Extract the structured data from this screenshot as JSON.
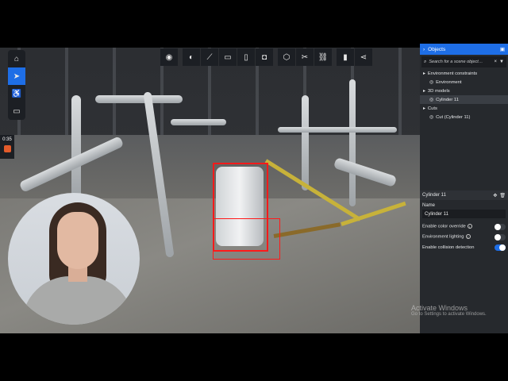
{
  "left_toolbar": {
    "items": [
      {
        "icon": "home-icon",
        "glyph": "⌂",
        "active": false
      },
      {
        "icon": "navigate-icon",
        "glyph": "➤",
        "active": true
      },
      {
        "icon": "walk-icon",
        "glyph": "♿",
        "active": false
      },
      {
        "icon": "vr-icon",
        "glyph": "▭",
        "active": false
      }
    ]
  },
  "recording": {
    "time": "0:35"
  },
  "top_toolbar": {
    "items": [
      {
        "icon": "eye-icon",
        "glyph": "◉"
      },
      {
        "icon": "contrast-icon",
        "glyph": "◐"
      },
      {
        "icon": "measure-icon",
        "glyph": "⟋"
      },
      {
        "icon": "comment-icon",
        "glyph": "▭"
      },
      {
        "icon": "document-icon",
        "glyph": "▯"
      },
      {
        "icon": "camera-icon",
        "glyph": "◘"
      },
      {
        "icon": "cube-icon",
        "glyph": "⬡"
      },
      {
        "icon": "scissors-icon",
        "glyph": "✂"
      },
      {
        "icon": "link-icon",
        "glyph": "⛓"
      },
      {
        "icon": "bookmark-icon",
        "glyph": "▮"
      },
      {
        "icon": "share-icon",
        "glyph": "⋖"
      }
    ]
  },
  "panel": {
    "title": "Objects",
    "search_placeholder": "Search for a scene object…",
    "tree": [
      {
        "label": "Environment constraints",
        "level": 0,
        "icon": "folder-icon"
      },
      {
        "label": "Environment",
        "level": 1,
        "icon": "object-icon"
      },
      {
        "label": "3D models",
        "level": 0,
        "icon": "folder-icon"
      },
      {
        "label": "Cylinder 11",
        "level": 1,
        "icon": "object-icon",
        "selected": true
      },
      {
        "label": "Cuts",
        "level": 0,
        "icon": "folder-icon"
      },
      {
        "label": "Cut (Cylinder 11)",
        "level": 1,
        "icon": "object-icon"
      }
    ],
    "properties": {
      "title": "Cylinder 11",
      "name_label": "Name",
      "name_value": "Cylinder 11",
      "toggles": [
        {
          "label": "Enable color override",
          "info": true,
          "on": false
        },
        {
          "label": "Environment lighting",
          "info": true,
          "on": false
        },
        {
          "label": "Enable collision detection",
          "info": false,
          "on": true
        }
      ]
    }
  },
  "watermark": {
    "title": "Activate Windows",
    "subtitle": "Go to Settings to activate Windows."
  }
}
